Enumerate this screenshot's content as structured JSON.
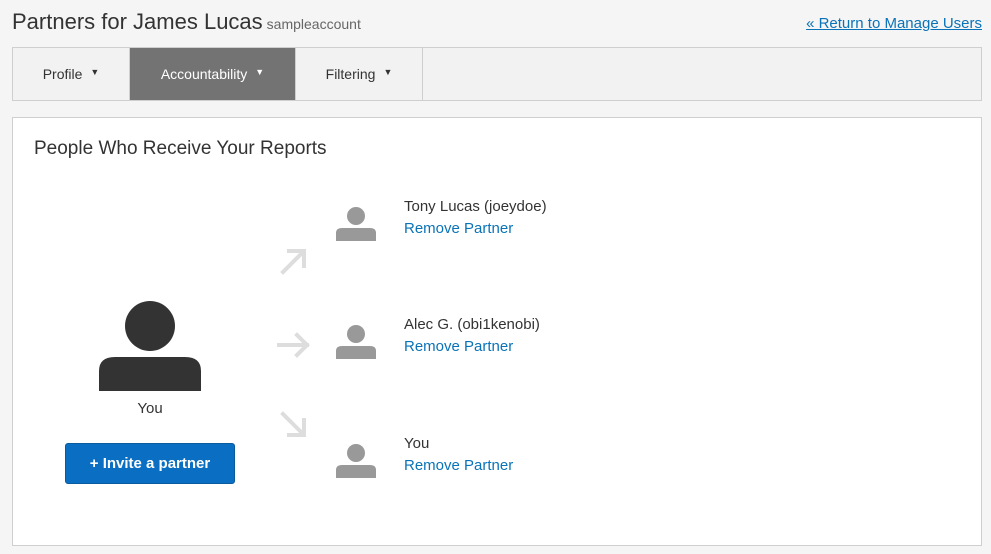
{
  "header": {
    "title": "Partners for James Lucas",
    "account": "sampleaccount",
    "return_link": "« Return to Manage Users"
  },
  "tabs": [
    {
      "label": "Profile",
      "caret": "▼",
      "active": false
    },
    {
      "label": "Accountability",
      "caret": "▼",
      "active": true
    },
    {
      "label": "Filtering",
      "caret": "▼",
      "active": false
    }
  ],
  "panel": {
    "title": "People Who Receive Your Reports",
    "you_label": "You",
    "invite_button": "+ Invite a partner",
    "partners": [
      {
        "name": "Tony Lucas (joeydoe)",
        "action": "Remove Partner"
      },
      {
        "name": "Alec G. (obi1kenobi)",
        "action": "Remove Partner"
      },
      {
        "name": "You",
        "action": "Remove Partner"
      }
    ]
  },
  "colors": {
    "link": "#0a73b8",
    "active_tab": "#737373",
    "button": "#0a6fc2",
    "avatar_dark": "#333333",
    "avatar_light": "#999999",
    "arrow": "#dddddd"
  },
  "icons": {
    "user_large": "user-silhouette-icon",
    "user_small": "user-silhouette-icon",
    "arrows": [
      "arrow-up-right-icon",
      "arrow-right-icon",
      "arrow-down-right-icon"
    ]
  }
}
